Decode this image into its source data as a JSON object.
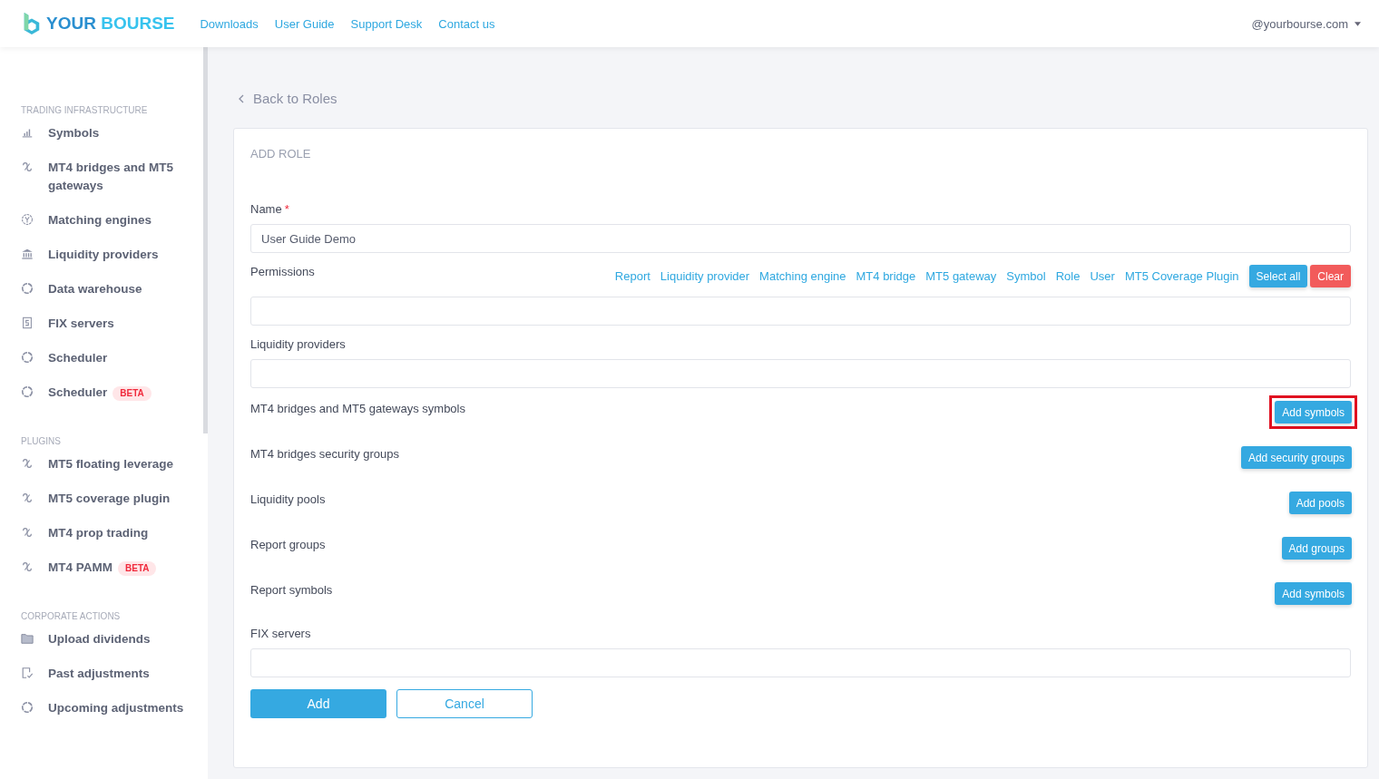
{
  "header": {
    "logo": "YOUR",
    "logo_accent": "BOURSE",
    "nav": [
      "Downloads",
      "User Guide",
      "Support Desk",
      "Contact us"
    ],
    "account": "@yourbourse.com"
  },
  "sidebar": {
    "sections": [
      {
        "title": "TRADING INFRASTRUCTURE",
        "items": [
          {
            "label": "Symbols",
            "kind": "bars"
          },
          {
            "label": "MT4 bridges and MT5 gateways",
            "kind": "link"
          },
          {
            "label": "Matching engines",
            "kind": "engine"
          },
          {
            "label": "Liquidity providers",
            "kind": "bank"
          },
          {
            "label": "Data warehouse",
            "kind": "circle"
          },
          {
            "label": "FIX servers",
            "kind": "server"
          },
          {
            "label": "Scheduler",
            "kind": "circle"
          },
          {
            "label": "Scheduler",
            "kind": "circle",
            "badge": "BETA"
          }
        ]
      },
      {
        "title": "PLUGINS",
        "items": [
          {
            "label": "MT5 floating leverage",
            "kind": "link"
          },
          {
            "label": "MT5 coverage plugin",
            "kind": "link"
          },
          {
            "label": "MT4 prop trading",
            "kind": "link"
          },
          {
            "label": "MT4 PAMM",
            "kind": "link",
            "badge": "BETA"
          }
        ]
      },
      {
        "title": "CORPORATE ACTIONS",
        "items": [
          {
            "label": "Upload dividends",
            "kind": "folder"
          },
          {
            "label": "Past adjustments",
            "kind": "doc"
          },
          {
            "label": "Upcoming adjustments",
            "kind": "circle"
          }
        ]
      }
    ]
  },
  "back_link": "Back to Roles",
  "form": {
    "title": "ADD ROLE",
    "fields": [
      {
        "kind": "input",
        "label": "Name",
        "required_mark": "*",
        "value": "User Guide Demo"
      },
      {
        "kind": "permissions",
        "label": "Permissions",
        "links": [
          "Report",
          "Liquidity provider",
          "Matching engine",
          "MT4 bridge",
          "MT5 gateway",
          "Symbol",
          "Role",
          "User",
          "MT5 Coverage Plugin"
        ],
        "select_all": "Select all",
        "clear": "Clear"
      },
      {
        "kind": "input",
        "label": "Liquidity providers"
      },
      {
        "kind": "button",
        "label": "MT4 bridges and MT5 gateways symbols",
        "button": "Add symbols",
        "highlighted": true
      },
      {
        "kind": "button",
        "label": "MT4 bridges security groups",
        "button": "Add security groups",
        "highlighted": false
      },
      {
        "kind": "button",
        "label": "Liquidity pools",
        "button": "Add pools",
        "highlighted": false
      },
      {
        "kind": "button",
        "label": "Report groups",
        "button": "Add groups",
        "highlighted": false
      },
      {
        "kind": "button",
        "label": "Report symbols",
        "button": "Add symbols",
        "highlighted": false
      },
      {
        "kind": "input",
        "label": "FIX servers"
      }
    ],
    "submit": "Add",
    "cancel": "Cancel"
  }
}
